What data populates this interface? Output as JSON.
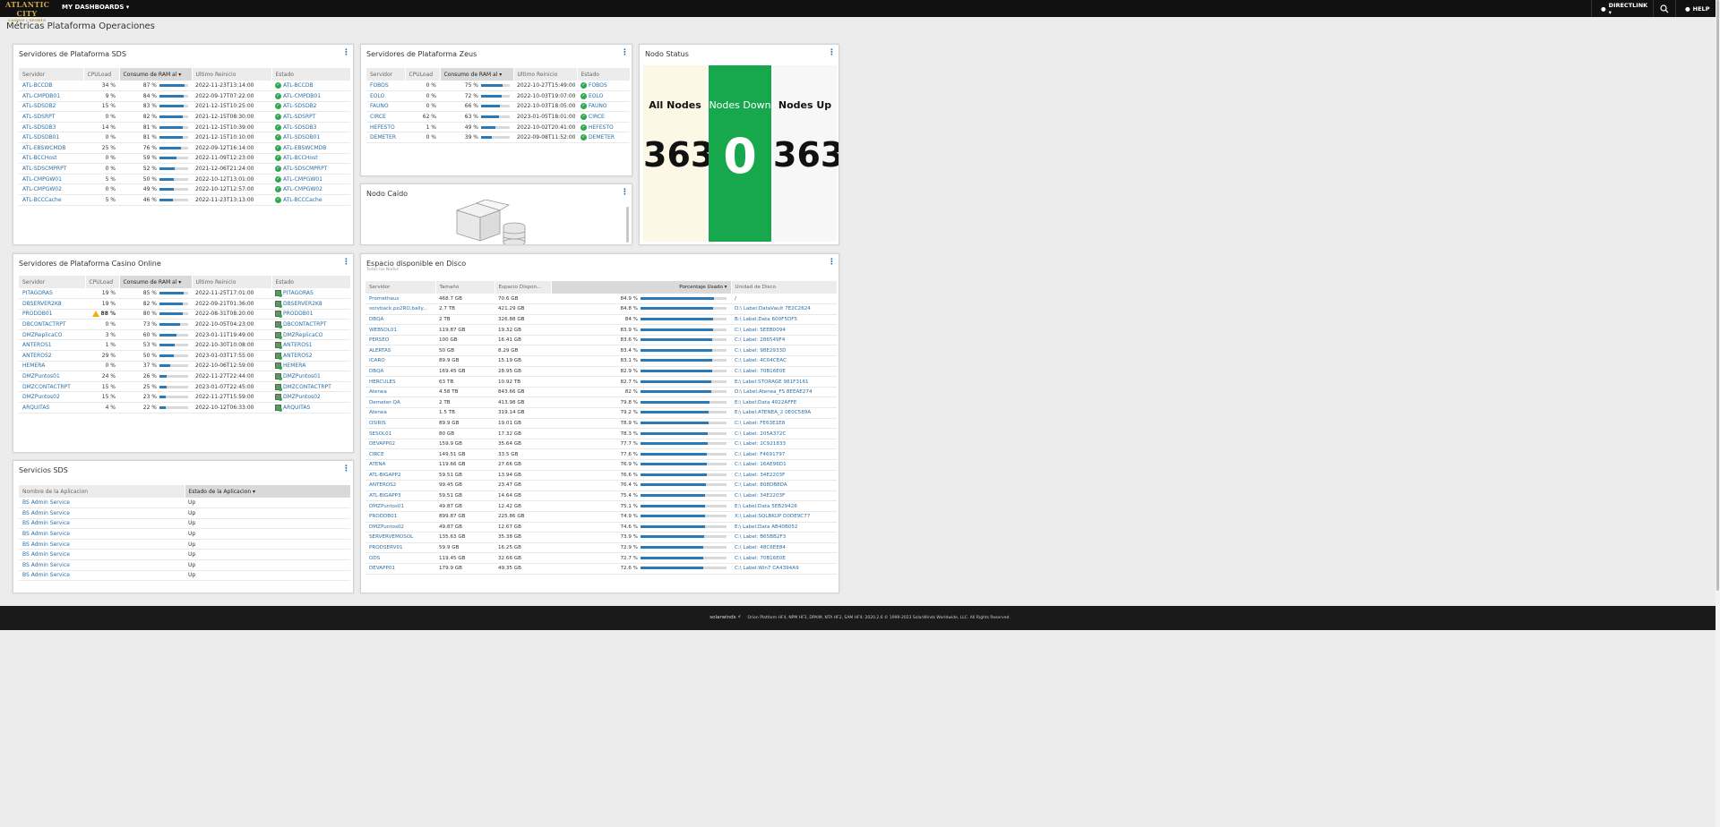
{
  "topbar": {
    "logo_line1": "ATLANTIC CITY",
    "logo_line2": "CASINO • SPORTS",
    "menu_label": "MY DASHBOARDS ▾",
    "user_label": "DIRECTLINK ▾",
    "help_label": "HELP"
  },
  "page_title": "Métricas Plataforma Operaciones",
  "colors": {
    "accent_link": "#2a6fa8",
    "bar_fill": "#2a7ab8",
    "status_ok": "#2fa84f",
    "all_nodes_bg": "#fdf7e5",
    "nodes_down_bg": "#17a74d",
    "nodes_up_bg": "#f7f7f7"
  },
  "sds": {
    "title": "Servidores de Plataforma SDS",
    "headers": [
      "Servidor",
      "CPULoad",
      "Consumo de RAM al ▾",
      "Ultimo Reinicio",
      "Estado"
    ],
    "rows": [
      {
        "name": "ATL-BCCDB",
        "cpu": "34 %",
        "ram": "87 %",
        "ram_pct": 87,
        "reboot": "2022-11-23T13:14:00",
        "status": "ATL-BCCDB"
      },
      {
        "name": "ATL-CMPDB01",
        "cpu": "9 %",
        "ram": "84 %",
        "ram_pct": 84,
        "reboot": "2022-09-17T07:22:00",
        "status": "ATL-CMPDB01"
      },
      {
        "name": "ATL-SDSDB2",
        "cpu": "15 %",
        "ram": "83 %",
        "ram_pct": 83,
        "reboot": "2021-12-15T10:25:00",
        "status": "ATL-SDSDB2"
      },
      {
        "name": "ATL-SDSRPT",
        "cpu": "0 %",
        "ram": "82 %",
        "ram_pct": 82,
        "reboot": "2021-12-15T08:30:00",
        "status": "ATL-SDSRPT"
      },
      {
        "name": "ATL-SDSDB3",
        "cpu": "14 %",
        "ram": "81 %",
        "ram_pct": 81,
        "reboot": "2021-12-15T10:39:00",
        "status": "ATL-SDSDB3"
      },
      {
        "name": "ATL-SDSDB01",
        "cpu": "0 %",
        "ram": "81 %",
        "ram_pct": 81,
        "reboot": "2021-12-15T10:10:00",
        "status": "ATL-SDSDB01"
      },
      {
        "name": "ATL-EBSWCMDB",
        "cpu": "25 %",
        "ram": "76 %",
        "ram_pct": 76,
        "reboot": "2022-09-12T16:14:00",
        "status": "ATL-EBSWCMDB"
      },
      {
        "name": "ATL-BCCHost",
        "cpu": "0 %",
        "ram": "59 %",
        "ram_pct": 59,
        "reboot": "2022-11-09T12:23:00",
        "status": "ATL-BCCHost"
      },
      {
        "name": "ATL-SDSCMPRPT",
        "cpu": "0 %",
        "ram": "52 %",
        "ram_pct": 52,
        "reboot": "2021-12-06T21:24:00",
        "status": "ATL-SDSCMPRPT"
      },
      {
        "name": "ATL-CMPGW01",
        "cpu": "5 %",
        "ram": "50 %",
        "ram_pct": 50,
        "reboot": "2022-10-12T13:01:00",
        "status": "ATL-CMPGW01"
      },
      {
        "name": "ATL-CMPGW02",
        "cpu": "0 %",
        "ram": "49 %",
        "ram_pct": 49,
        "reboot": "2022-10-12T12:57:00",
        "status": "ATL-CMPGW02"
      },
      {
        "name": "ATL-BCCCache",
        "cpu": "5 %",
        "ram": "46 %",
        "ram_pct": 46,
        "reboot": "2022-11-23T13:13:00",
        "status": "ATL-BCCCache"
      }
    ]
  },
  "zeus": {
    "title": "Servidores de Plataforma Zeus",
    "headers": [
      "Servidor",
      "CPULoad",
      "Consumo de RAM al ▾",
      "Ultimo Reinicio",
      "Estado"
    ],
    "rows": [
      {
        "name": "FOBOS",
        "cpu": "0 %",
        "ram": "75 %",
        "ram_pct": 75,
        "reboot": "2022-10-27T15:49:00",
        "status": "FOBOS"
      },
      {
        "name": "EOLO",
        "cpu": "0 %",
        "ram": "72 %",
        "ram_pct": 72,
        "reboot": "2022-10-03T19:07:00",
        "status": "EOLO"
      },
      {
        "name": "FAUNO",
        "cpu": "0 %",
        "ram": "66 %",
        "ram_pct": 66,
        "reboot": "2022-10-03T18:05:00",
        "status": "FAUNO"
      },
      {
        "name": "CIRCE",
        "cpu": "62 %",
        "ram": "63 %",
        "ram_pct": 63,
        "reboot": "2023-01-05T18:01:00",
        "status": "CIRCE"
      },
      {
        "name": "HEFESTO",
        "cpu": "1 %",
        "ram": "49 %",
        "ram_pct": 49,
        "reboot": "2022-10-02T20:41:00",
        "status": "HEFESTO"
      },
      {
        "name": "DEMETER",
        "cpu": "0 %",
        "ram": "39 %",
        "ram_pct": 39,
        "reboot": "2022-09-08T11:52:00",
        "status": "DEMETER"
      }
    ]
  },
  "nodo_caido": {
    "title": "Nodo Caído"
  },
  "nodo_status": {
    "title": "Nodo Status",
    "all_label": "All Nodes",
    "all_value": "363",
    "down_label": "Nodes Down",
    "down_value": "0",
    "up_label": "Nodes Up",
    "up_value": "363"
  },
  "casino": {
    "title": "Servidores de Plataforma Casino Online",
    "headers": [
      "Servidor",
      "CPULoad",
      "Consumo de RAM al ▾",
      "Ultimo Reinicio",
      "Estado"
    ],
    "rows": [
      {
        "name": "PITAGORAS",
        "cpu": "19 %",
        "ram": "85 %",
        "ram_pct": 85,
        "reboot": "2022-11-25T17:01:00",
        "status": "PITAGORAS",
        "warn": false
      },
      {
        "name": "DBSERVER2K8",
        "cpu": "19 %",
        "ram": "82 %",
        "ram_pct": 82,
        "reboot": "2022-09-21T01:36:00",
        "status": "DBSERVER2K8",
        "warn": false
      },
      {
        "name": "PRODDB01",
        "cpu": "88 %",
        "ram": "80 %",
        "ram_pct": 80,
        "reboot": "2022-08-31T08:20:00",
        "status": "PRODDB01",
        "warn": true
      },
      {
        "name": "DBCONTACTRPT",
        "cpu": "0 %",
        "ram": "73 %",
        "ram_pct": 73,
        "reboot": "2022-10-05T04:23:00",
        "status": "DBCONTACTRPT",
        "warn": false
      },
      {
        "name": "DMZReplicaCO",
        "cpu": "3 %",
        "ram": "60 %",
        "ram_pct": 60,
        "reboot": "2023-01-11T19:49:00",
        "status": "DMZReplicaCO",
        "warn": false
      },
      {
        "name": "ANTEROS1",
        "cpu": "1 %",
        "ram": "53 %",
        "ram_pct": 53,
        "reboot": "2022-10-30T10:08:00",
        "status": "ANTEROS1",
        "warn": false
      },
      {
        "name": "ANTEROS2",
        "cpu": "29 %",
        "ram": "50 %",
        "ram_pct": 50,
        "reboot": "2023-01-03T17:55:00",
        "status": "ANTEROS2",
        "warn": false
      },
      {
        "name": "HEMERA",
        "cpu": "0 %",
        "ram": "37 %",
        "ram_pct": 37,
        "reboot": "2022-10-06T12:59:00",
        "status": "HEMERA",
        "warn": false
      },
      {
        "name": "DMZPuntos01",
        "cpu": "24 %",
        "ram": "26 %",
        "ram_pct": 26,
        "reboot": "2022-11-27T22:44:00",
        "status": "DMZPuntos01",
        "warn": false
      },
      {
        "name": "DMZCONTACTRPT",
        "cpu": "15 %",
        "ram": "25 %",
        "ram_pct": 25,
        "reboot": "2023-01-07T22:45:00",
        "status": "DMZCONTACTRPT",
        "warn": false
      },
      {
        "name": "DMZPuntos02",
        "cpu": "15 %",
        "ram": "23 %",
        "ram_pct": 23,
        "reboot": "2022-11-27T15:59:00",
        "status": "DMZPuntos02",
        "warn": false
      },
      {
        "name": "ARQUITAS",
        "cpu": "4 %",
        "ram": "22 %",
        "ram_pct": 22,
        "reboot": "2022-10-12T06:33:00",
        "status": "ARQUITAS",
        "warn": false
      }
    ]
  },
  "servicios": {
    "title": "Servicios SDS",
    "headers": [
      "Nombre de la Aplicacion",
      "Estado de la Aplicacion ▾"
    ],
    "rows": [
      {
        "name": "BS Admin Service",
        "state": "Up"
      },
      {
        "name": "BS Admin Service",
        "state": "Up"
      },
      {
        "name": "BS Admin Service",
        "state": "Up"
      },
      {
        "name": "BS Admin Service",
        "state": "Up"
      },
      {
        "name": "BS Admin Service",
        "state": "Up"
      },
      {
        "name": "BS Admin Service",
        "state": "Up"
      },
      {
        "name": "BS Admin Service",
        "state": "Up"
      },
      {
        "name": "BS Admin Service",
        "state": "Up"
      }
    ]
  },
  "disco": {
    "title": "Espacio disponible en Disco",
    "subtitle": "Todos los Nodos",
    "headers": [
      "Servidor",
      "Tamaño",
      "Espacio Dispon...",
      "Porcentaje Usado ▾",
      "Unidad de Disco"
    ],
    "rows": [
      {
        "server": "Prometheus",
        "size": "468.7 GB",
        "free": "70.6 GB",
        "pct": "84.9 %",
        "pct_val": 84.9,
        "unit": "/"
      },
      {
        "server": "sorvback.po2RO.bally...",
        "size": "2.7 TB",
        "free": "421.29 GB",
        "pct": "84.8 %",
        "pct_val": 84.8,
        "unit": "D:\\ Label:DataVault 7E2C2624"
      },
      {
        "server": "DBQA",
        "size": "2 TB",
        "free": "326.88 GB",
        "pct": "84 %",
        "pct_val": 84,
        "unit": "B:\\ Label:Data 600F5DF5"
      },
      {
        "server": "WEBSOL01",
        "size": "119.87 GB",
        "free": "19.32 GB",
        "pct": "83.9 %",
        "pct_val": 83.9,
        "unit": "C:\\ Label: 5EEB0094"
      },
      {
        "server": "PERSEO",
        "size": "100 GB",
        "free": "16.41 GB",
        "pct": "83.6 %",
        "pct_val": 83.6,
        "unit": "C:\\ Label: 286549F4"
      },
      {
        "server": "ALERTAS",
        "size": "50 GB",
        "free": "8.29 GB",
        "pct": "83.4 %",
        "pct_val": 83.4,
        "unit": "C:\\ Label: 98E2933D"
      },
      {
        "server": "ICARO",
        "size": "89.9 GB",
        "free": "15.19 GB",
        "pct": "83.1 %",
        "pct_val": 83.1,
        "unit": "C:\\ Label: 4C04CEAC"
      },
      {
        "server": "DBQA",
        "size": "169.45 GB",
        "free": "28.95 GB",
        "pct": "82.9 %",
        "pct_val": 82.9,
        "unit": "C:\\ Label: 70B16E0E"
      },
      {
        "server": "HERCULES",
        "size": "63 TB",
        "free": "10.92 TB",
        "pct": "82.7 %",
        "pct_val": 82.7,
        "unit": "E:\\ Label:STORAGE 981F3161"
      },
      {
        "server": "Atenea",
        "size": "4.58 TB",
        "free": "843.66 GB",
        "pct": "82 %",
        "pct_val": 82,
        "unit": "D:\\ Label:Atenea_FS 8EEAE274"
      },
      {
        "server": "Demeter-QA",
        "size": "2 TB",
        "free": "413.98 GB",
        "pct": "79.8 %",
        "pct_val": 79.8,
        "unit": "E:\\ Label:Data 4022AFFE"
      },
      {
        "server": "Atenea",
        "size": "1.5 TB",
        "free": "319.14 GB",
        "pct": "79.2 %",
        "pct_val": 79.2,
        "unit": "E:\\ Label:ATENEA_2 0E0C589A"
      },
      {
        "server": "OSIRIS",
        "size": "89.9 GB",
        "free": "19.01 GB",
        "pct": "78.9 %",
        "pct_val": 78.9,
        "unit": "C:\\ Label: FE63E1E8"
      },
      {
        "server": "SESOL01",
        "size": "80 GB",
        "free": "17.32 GB",
        "pct": "78.3 %",
        "pct_val": 78.3,
        "unit": "C:\\ Label: 205A372C"
      },
      {
        "server": "DEVAPP02",
        "size": "159.9 GB",
        "free": "35.64 GB",
        "pct": "77.7 %",
        "pct_val": 77.7,
        "unit": "C:\\ Label: 2C921833"
      },
      {
        "server": "CIRCE",
        "size": "149.51 GB",
        "free": "33.5 GB",
        "pct": "77.6 %",
        "pct_val": 77.6,
        "unit": "C:\\ Label: F4691797"
      },
      {
        "server": "ATENA",
        "size": "119.66 GB",
        "free": "27.66 GB",
        "pct": "76.9 %",
        "pct_val": 76.9,
        "unit": "C:\\ Label: 16AE96D1"
      },
      {
        "server": "ATL-BIGAPP2",
        "size": "59.51 GB",
        "free": "13.94 GB",
        "pct": "76.6 %",
        "pct_val": 76.6,
        "unit": "C:\\ Label: 34E2203F"
      },
      {
        "server": "ANTEROS2",
        "size": "99.45 GB",
        "free": "23.47 GB",
        "pct": "76.4 %",
        "pct_val": 76.4,
        "unit": "C:\\ Label: 808DB8DA"
      },
      {
        "server": "ATL-BIGAPP3",
        "size": "59.51 GB",
        "free": "14.64 GB",
        "pct": "75.4 %",
        "pct_val": 75.4,
        "unit": "C:\\ Label: 34E2203F"
      },
      {
        "server": "DMZPuntos01",
        "size": "49.87 GB",
        "free": "12.42 GB",
        "pct": "75.1 %",
        "pct_val": 75.1,
        "unit": "E:\\ Label:Data 5EB29426"
      },
      {
        "server": "PRODDB01",
        "size": "899.87 GB",
        "free": "225.86 GB",
        "pct": "74.9 %",
        "pct_val": 74.9,
        "unit": "X:\\ Label:SQLBKUP D0DE9C77"
      },
      {
        "server": "DMZPuntos02",
        "size": "49.87 GB",
        "free": "12.67 GB",
        "pct": "74.6 %",
        "pct_val": 74.6,
        "unit": "E:\\ Label:Data AB40B052"
      },
      {
        "server": "SERVERVEMOSOL",
        "size": "135.63 GB",
        "free": "35.38 GB",
        "pct": "73.9 %",
        "pct_val": 73.9,
        "unit": "C:\\ Label: B65BB2F3"
      },
      {
        "server": "PRODSERV01",
        "size": "59.9 GB",
        "free": "16.25 GB",
        "pct": "72.9 %",
        "pct_val": 72.9,
        "unit": "C:\\ Label: 48C6EE84"
      },
      {
        "server": "ODS",
        "size": "119.45 GB",
        "free": "32.66 GB",
        "pct": "72.7 %",
        "pct_val": 72.7,
        "unit": "C:\\ Label: 70B16E0E"
      },
      {
        "server": "DEVAPP01",
        "size": "179.9 GB",
        "free": "49.35 GB",
        "pct": "72.6 %",
        "pct_val": 72.6,
        "unit": "C:\\ Label:Win7 CA4394A9"
      }
    ]
  },
  "footer": {
    "brand": "solarwinds ⚡",
    "text": "Orion Platform HF4, NPM HF3, DPAIM, NTA HF2, SAM HF4: 2020.2.6 © 1999-2023 SolarWinds Worldwide, LLC. All Rights Reserved."
  }
}
